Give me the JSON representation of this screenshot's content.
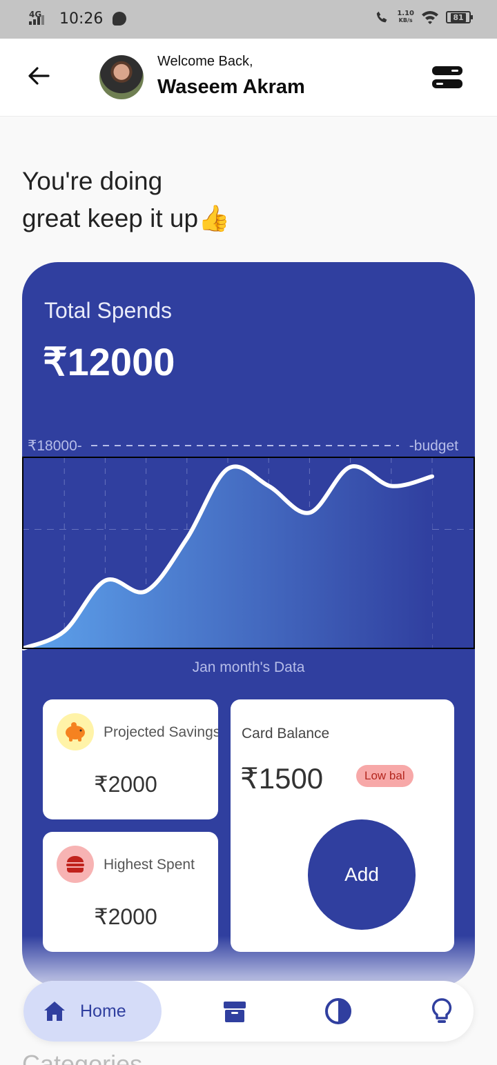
{
  "status_bar": {
    "network": "4G",
    "time": "10:26",
    "speed_value": "1.10",
    "speed_unit": "KB/s",
    "battery": "81"
  },
  "header": {
    "welcome": "Welcome Back,",
    "username": "Waseem Akram",
    "back_icon": "arrow-left-icon",
    "menu_icon": "menu-toggle-icon"
  },
  "greeting": {
    "line1": "You're doing",
    "line2": "great keep it up👍"
  },
  "summary": {
    "total_label": "Total Spends",
    "total_value": "₹12000"
  },
  "chart_data": {
    "type": "area",
    "budget_label": "₹18000-",
    "budget_suffix": "-budget",
    "budget": 18000,
    "caption": "Jan month's Data",
    "grid": true,
    "x": [
      0,
      1,
      2,
      3,
      4,
      5,
      6,
      7,
      8,
      9,
      10
    ],
    "values": [
      0,
      1800,
      7100,
      6000,
      11500,
      18800,
      17000,
      14200,
      19000,
      17000,
      18000
    ],
    "ylim": [
      0,
      20000
    ],
    "colors": {
      "line": "#ffffff",
      "fill_start": "#5ea3ec",
      "fill_end": "#303f9f",
      "grid": "#8c97d3"
    }
  },
  "stats": {
    "savings": {
      "title": "Projected Savings",
      "value": "₹2000",
      "icon": "piggy-bank-icon"
    },
    "highest": {
      "title": "Highest Spent",
      "value": "₹2000",
      "icon": "burger-icon"
    },
    "balance": {
      "title": "Card Balance",
      "value": "₹1500",
      "badge": "Low bal",
      "add_label": "Add"
    }
  },
  "nav": {
    "home_label": "Home",
    "home_icon": "home-icon",
    "items": [
      "box-icon",
      "contrast-icon",
      "lightbulb-icon"
    ]
  },
  "next_section": "Categories",
  "colors": {
    "primary": "#303f9f",
    "low_badge_bg": "#f7a8a8",
    "low_badge_text": "#b3261e",
    "nav_active": "#d5dcf8"
  }
}
